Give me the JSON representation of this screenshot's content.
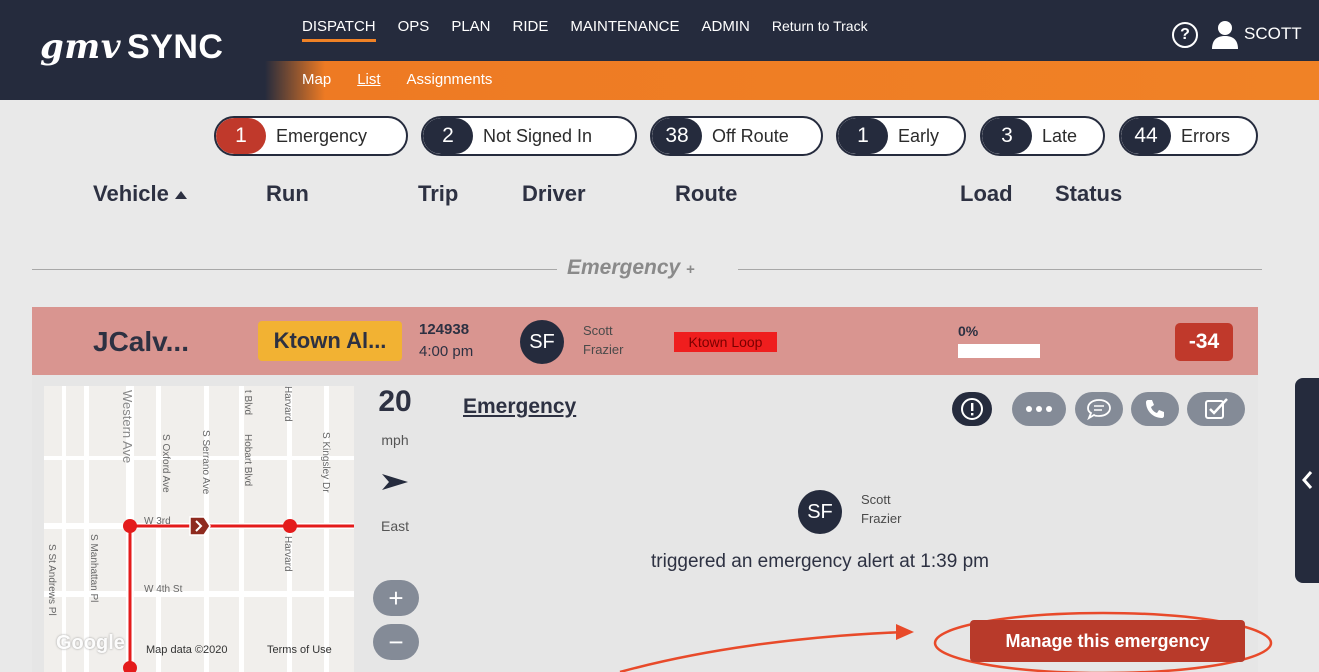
{
  "app": {
    "logo_mark": "gmv",
    "logo_text": "SYNC"
  },
  "topnav": [
    "DISPATCH",
    "OPS",
    "PLAN",
    "RIDE",
    "MAINTENANCE",
    "ADMIN",
    "Return to Track"
  ],
  "subnav": [
    "Map",
    "List",
    "Assignments"
  ],
  "user": {
    "name": "SCOTT",
    "help_glyph": "?"
  },
  "pills": [
    {
      "count": "1",
      "label": "Emergency",
      "color": "#c0392b"
    },
    {
      "count": "2",
      "label": "Not Signed In"
    },
    {
      "count": "38",
      "label": "Off Route"
    },
    {
      "count": "1",
      "label": "Early"
    },
    {
      "count": "3",
      "label": "Late"
    },
    {
      "count": "44",
      "label": "Errors"
    }
  ],
  "columns": {
    "vehicle": "Vehicle",
    "run": "Run",
    "trip": "Trip",
    "driver": "Driver",
    "route": "Route",
    "load": "Load",
    "status": "Status"
  },
  "section": {
    "label": "Emergency",
    "suffix": "+"
  },
  "row": {
    "vehicle": "JCalv...",
    "run": "Ktown Al...",
    "trip_number": "124938",
    "trip_time": "4:00 pm",
    "driver_initials": "SF",
    "driver_first": "Scott",
    "driver_last": "Frazier",
    "route": "Ktown Loop",
    "load_percent": "0%",
    "load_fraction": 0,
    "status": "-34"
  },
  "map": {
    "streets": [
      "Western Ave",
      "S Oxford Ave",
      "S Serrano Ave",
      "Hobart Blvd",
      "Harvard",
      "S Kingsley Dr",
      "W 3rd",
      "W 4th St",
      "S Manhattan Pl",
      "S St Andrews Pl",
      "t Blvd",
      "Harvard"
    ],
    "footer": "Map data ©2020",
    "terms": "Terms of Use",
    "brand": "Google"
  },
  "telemetry": {
    "speed": "20",
    "unit": "mph",
    "heading": "East",
    "zoom_in": "+",
    "zoom_out": "−"
  },
  "detail": {
    "title": "Emergency",
    "driver_initials": "SF",
    "driver_first": "Scott",
    "driver_last": "Frazier",
    "message": "triggered an emergency alert at 1:39 pm",
    "manage_button": "Manage this emergency"
  },
  "actions": [
    "alert-icon",
    "more-icon",
    "chat-icon",
    "phone-icon",
    "checklist-icon"
  ],
  "colors": {
    "navy": "#252b3d",
    "orange": "#f08226",
    "red": "#c0392b",
    "row_bg": "#d99590",
    "run_yellow": "#f2b233"
  }
}
